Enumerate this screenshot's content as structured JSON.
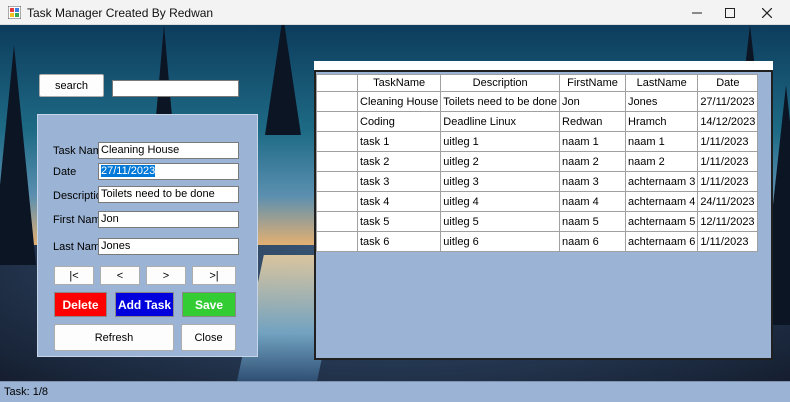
{
  "window": {
    "title": "Task Manager Created By Redwan"
  },
  "search": {
    "button_label": "search",
    "value": ""
  },
  "form": {
    "labels": {
      "task_name": "Task Name",
      "date": "Date",
      "description": "Description",
      "first_name": "First Name",
      "last_name": "Last Name"
    },
    "values": {
      "task_name": "Cleaning House",
      "date": "27/11/2023",
      "description": "Toilets need to be done",
      "first_name": "Jon",
      "last_name": "Jones"
    }
  },
  "nav": {
    "first": "|<",
    "prev": "<",
    "next": ">",
    "last": ">|"
  },
  "actions": {
    "delete": "Delete",
    "add": "Add Task",
    "save": "Save",
    "refresh": "Refresh",
    "close": "Close"
  },
  "colors": {
    "delete": "#ff0000",
    "add": "#0000dd",
    "save": "#33cc33",
    "panel": "#9bb3d4"
  },
  "grid": {
    "columns": [
      "TaskName",
      "Description",
      "FirstName",
      "LastName",
      "Date"
    ],
    "rows": [
      [
        "Cleaning House",
        "Toilets need to be done",
        "Jon",
        "Jones",
        "27/11/2023"
      ],
      [
        "Coding",
        "Deadline Linux",
        "Redwan",
        "Hramch",
        "14/12/2023"
      ],
      [
        "task 1",
        "uitleg 1",
        "naam 1",
        "naam 1",
        "1/11/2023"
      ],
      [
        "task 2",
        "uitleg 2",
        "naam 2",
        "naam 2",
        "1/11/2023"
      ],
      [
        "task 3",
        "uitleg 3",
        "naam 3",
        "achternaam 3",
        "1/11/2023"
      ],
      [
        "task 4",
        "uitleg 4",
        "naam 4",
        "achternaam 4",
        "24/11/2023"
      ],
      [
        "task 5",
        "uitleg 5",
        "naam 5",
        "achternaam 5",
        "12/11/2023"
      ],
      [
        "task 6",
        "uitleg 6",
        "naam 6",
        "achternaam 6",
        "1/11/2023"
      ]
    ]
  },
  "status": {
    "text": "Task: 1/8"
  }
}
